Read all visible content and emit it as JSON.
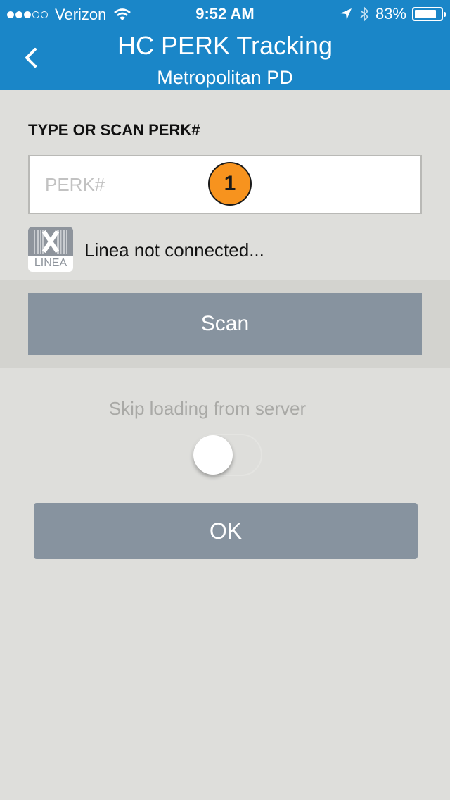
{
  "status_bar": {
    "carrier": "Verizon",
    "time": "9:52 AM",
    "battery": "83%",
    "battery_level": 0.83
  },
  "header": {
    "title": "HC PERK Tracking",
    "subtitle": "Metropolitan PD",
    "back_icon": "chevron-left-icon"
  },
  "form": {
    "perk_label": "TYPE OR SCAN PERK#",
    "perk_placeholder": "PERK#",
    "perk_value": "",
    "badge": "1",
    "linea_logo_text": "LINEA",
    "linea_status": "Linea not connected...",
    "scan_label": "Scan",
    "skip_label": "Skip loading from server",
    "skip_toggle_on": false,
    "ok_label": "OK"
  },
  "colors": {
    "header": "#1a86c8",
    "background": "#dededb",
    "button": "#87939f",
    "badge": "#f7931e"
  }
}
